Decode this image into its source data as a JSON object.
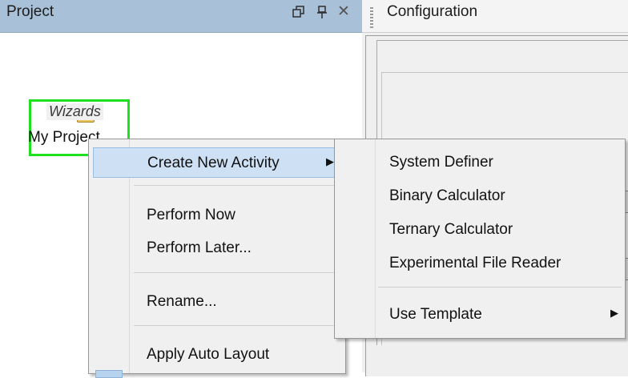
{
  "project_panel": {
    "title": "Project",
    "header_icons": [
      "restore-icon",
      "pin-icon",
      "close-icon"
    ],
    "node": {
      "label": "My Project",
      "icon": "folder-icon"
    }
  },
  "config_panel": {
    "title": "Configuration",
    "group_label": "Wizards"
  },
  "context_menu": {
    "items": [
      {
        "label": "Create New Activity",
        "has_submenu": true,
        "highlighted": true
      },
      {
        "label": "Perform Now"
      },
      {
        "label": "Perform Later..."
      },
      {
        "label": "Rename..."
      },
      {
        "label": "Apply Auto Layout"
      }
    ]
  },
  "submenu": {
    "items": [
      {
        "label": "System Definer"
      },
      {
        "label": "Binary Calculator"
      },
      {
        "label": "Ternary Calculator"
      },
      {
        "label": "Experimental File Reader"
      },
      {
        "label": "Use Template",
        "has_submenu": true
      }
    ]
  },
  "colors": {
    "panel_header": "#a8c0d8",
    "selection_border": "#1ee01e",
    "menu_highlight": "#cde0f4",
    "menu_background": "#f0f0f0"
  }
}
